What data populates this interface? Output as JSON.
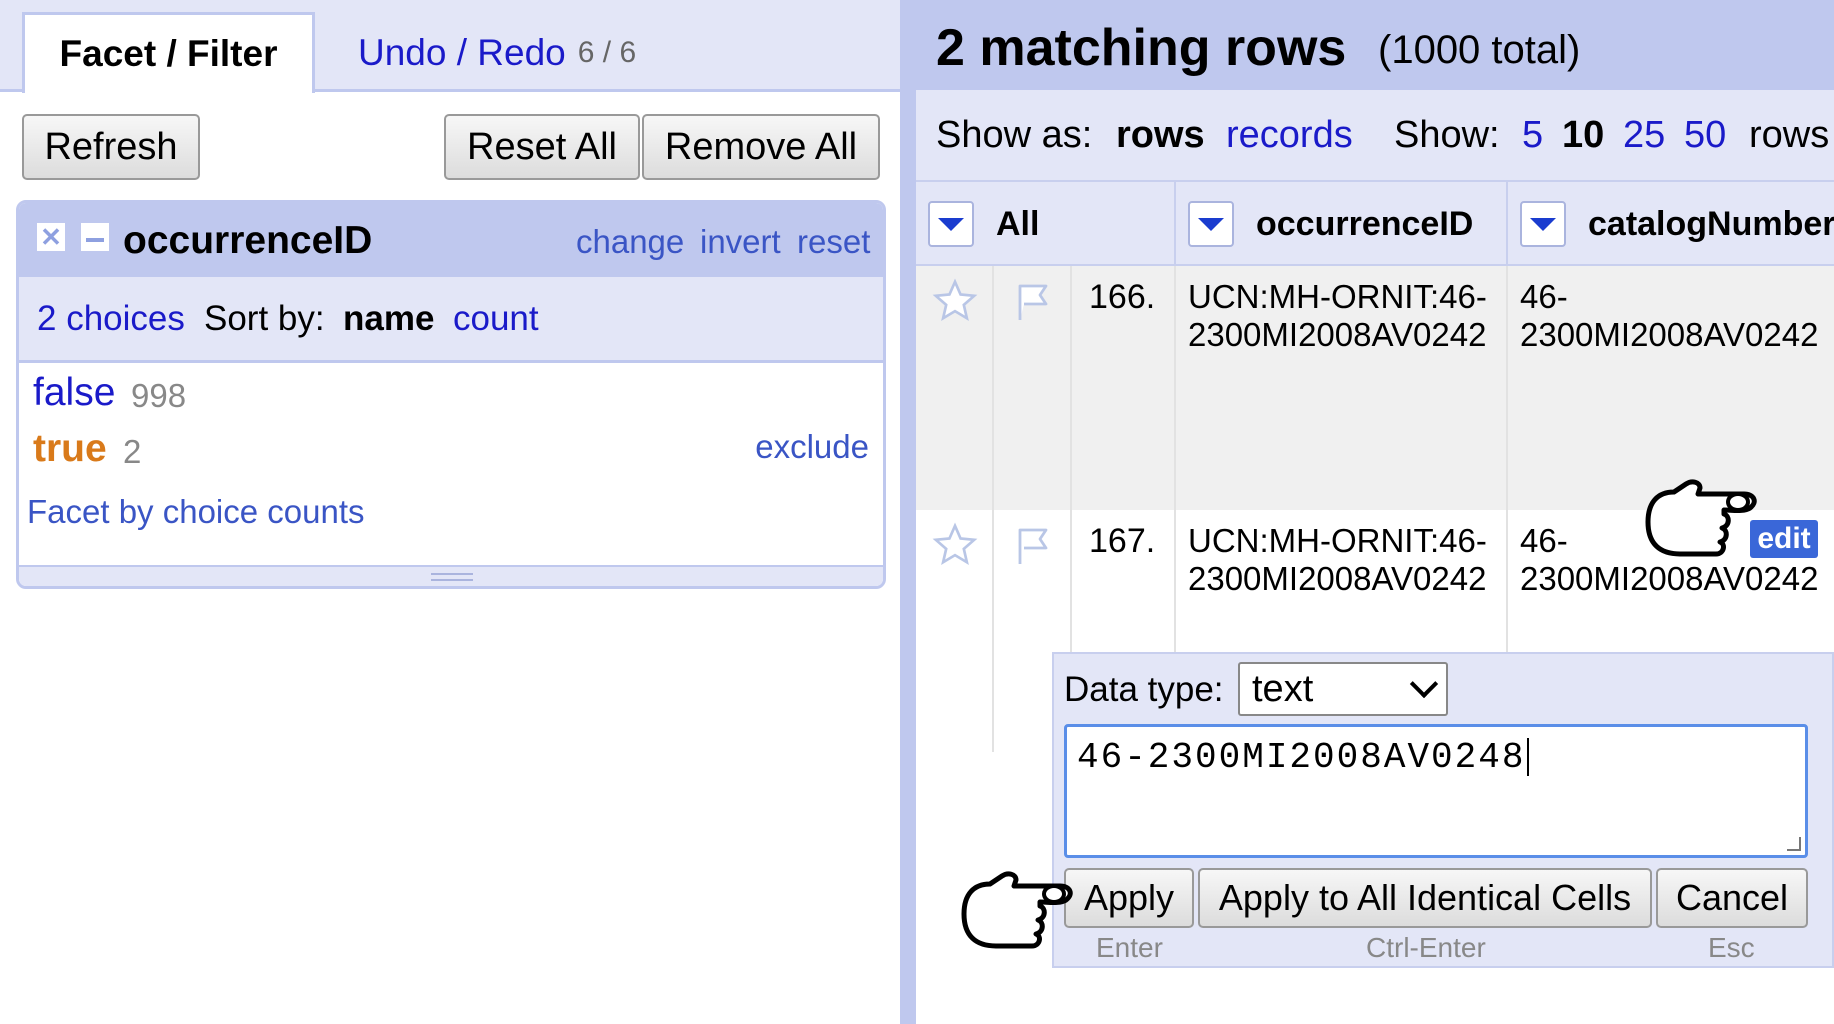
{
  "left": {
    "tabs": {
      "facet": "Facet / Filter",
      "undo": "Undo / Redo",
      "undo_count": "6 / 6"
    },
    "buttons": {
      "refresh": "Refresh",
      "reset_all": "Reset All",
      "remove_all": "Remove All"
    },
    "facet": {
      "title": "occurrenceID",
      "close_glyph": "✕",
      "links": {
        "change": "change",
        "invert": "invert",
        "reset": "reset"
      },
      "choice_count": "2 choices",
      "sort_by_label": "Sort by:",
      "sort_name": "name",
      "sort_count": "count",
      "choices": [
        {
          "label": "false",
          "count": "998",
          "selected": false
        },
        {
          "label": "true",
          "count": "2",
          "selected": true,
          "action": "exclude"
        }
      ],
      "facet_by_counts": "Facet by choice counts"
    }
  },
  "right": {
    "summary": {
      "title": "2 matching rows",
      "total": "(1000 total)"
    },
    "view": {
      "show_as_label": "Show as:",
      "rows": "rows",
      "records": "records",
      "show_label": "Show:",
      "page_sizes": [
        "5",
        "10",
        "25",
        "50"
      ],
      "selected_page_size": "10",
      "rows_suffix": "rows"
    },
    "columns": [
      "All",
      "occurrenceID",
      "catalogNumber"
    ],
    "rows": [
      {
        "num": "166.",
        "occurrenceID": [
          "UCN:MH-ORNIT:46-",
          "2300MI2008AV0242"
        ],
        "catalogNumber": [
          "46-",
          "2300MI2008AV0242"
        ]
      },
      {
        "num": "167.",
        "occurrenceID": [
          "UCN:MH-ORNIT:46-",
          "2300MI2008AV0242"
        ],
        "catalogNumber": [
          "46-",
          "2300MI2008AV0242"
        ]
      }
    ],
    "edit_badge": "edit",
    "editor": {
      "data_type_label": "Data type:",
      "data_type_value": "text",
      "value": "46-2300MI2008AV0248",
      "buttons": {
        "apply": "Apply",
        "apply_all": "Apply to All Identical Cells",
        "cancel": "Cancel"
      },
      "shortcuts": {
        "apply": "Enter",
        "apply_all": "Ctrl-Enter",
        "cancel": "Esc"
      }
    }
  },
  "colors": {
    "accent_dark": "#bfc8ee",
    "accent_light": "#e3e6f7",
    "link": "#1a1ac9",
    "selected_choice": "#d97a1a",
    "edit_badge": "#3a67d8"
  },
  "icons": [
    "close-icon",
    "minimize-icon",
    "column-menu-icon",
    "star-icon",
    "flag-icon",
    "chevron-down-icon",
    "pointing-hand-icon"
  ]
}
